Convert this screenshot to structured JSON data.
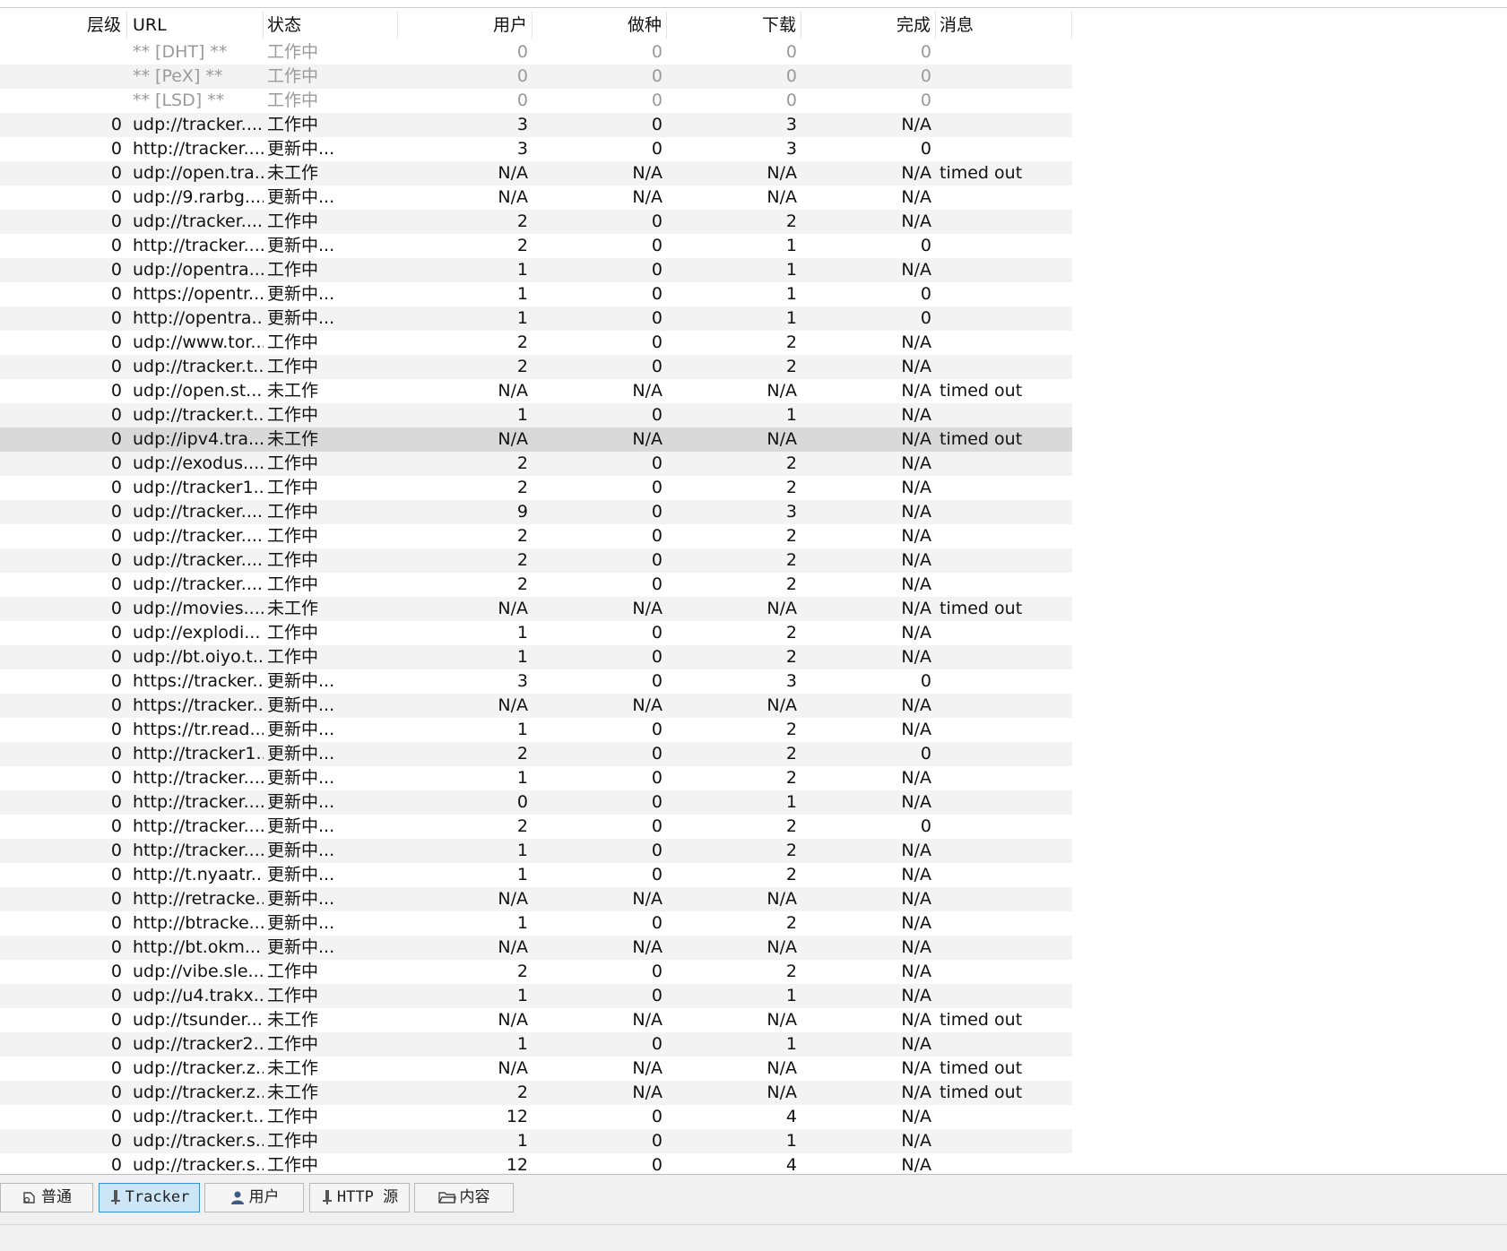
{
  "columns": {
    "tier": "层级",
    "url": "URL",
    "status": "状态",
    "peers": "用户",
    "seeds": "做种",
    "leeches": "下载",
    "downloaded": "完成",
    "message": "消息"
  },
  "rows": [
    {
      "tier": "",
      "url": "** [DHT] **",
      "status": "工作中",
      "peers": "0",
      "seeds": "0",
      "leeches": "0",
      "downloaded": "0",
      "message": "",
      "special": true
    },
    {
      "tier": "",
      "url": "** [PeX] **",
      "status": "工作中",
      "peers": "0",
      "seeds": "0",
      "leeches": "0",
      "downloaded": "0",
      "message": "",
      "special": true
    },
    {
      "tier": "",
      "url": "** [LSD] **",
      "status": "工作中",
      "peers": "0",
      "seeds": "0",
      "leeches": "0",
      "downloaded": "0",
      "message": "",
      "special": true
    },
    {
      "tier": "0",
      "url": "udp://tracker....",
      "status": "工作中",
      "peers": "3",
      "seeds": "0",
      "leeches": "3",
      "downloaded": "N/A",
      "message": ""
    },
    {
      "tier": "0",
      "url": "http://tracker....",
      "status": "更新中...",
      "peers": "3",
      "seeds": "0",
      "leeches": "3",
      "downloaded": "0",
      "message": ""
    },
    {
      "tier": "0",
      "url": "udp://open.tra...",
      "status": "未工作",
      "peers": "N/A",
      "seeds": "N/A",
      "leeches": "N/A",
      "downloaded": "N/A",
      "message": "timed out"
    },
    {
      "tier": "0",
      "url": "udp://9.rarbg....",
      "status": "更新中...",
      "peers": "N/A",
      "seeds": "N/A",
      "leeches": "N/A",
      "downloaded": "N/A",
      "message": ""
    },
    {
      "tier": "0",
      "url": "udp://tracker....",
      "status": "工作中",
      "peers": "2",
      "seeds": "0",
      "leeches": "2",
      "downloaded": "N/A",
      "message": ""
    },
    {
      "tier": "0",
      "url": "http://tracker....",
      "status": "更新中...",
      "peers": "2",
      "seeds": "0",
      "leeches": "1",
      "downloaded": "0",
      "message": ""
    },
    {
      "tier": "0",
      "url": "udp://opentra...",
      "status": "工作中",
      "peers": "1",
      "seeds": "0",
      "leeches": "1",
      "downloaded": "N/A",
      "message": ""
    },
    {
      "tier": "0",
      "url": "https://opentr...",
      "status": "更新中...",
      "peers": "1",
      "seeds": "0",
      "leeches": "1",
      "downloaded": "0",
      "message": ""
    },
    {
      "tier": "0",
      "url": "http://opentra...",
      "status": "更新中...",
      "peers": "1",
      "seeds": "0",
      "leeches": "1",
      "downloaded": "0",
      "message": ""
    },
    {
      "tier": "0",
      "url": "udp://www.tor...",
      "status": "工作中",
      "peers": "2",
      "seeds": "0",
      "leeches": "2",
      "downloaded": "N/A",
      "message": ""
    },
    {
      "tier": "0",
      "url": "udp://tracker.t...",
      "status": "工作中",
      "peers": "2",
      "seeds": "0",
      "leeches": "2",
      "downloaded": "N/A",
      "message": ""
    },
    {
      "tier": "0",
      "url": "udp://open.st...",
      "status": "未工作",
      "peers": "N/A",
      "seeds": "N/A",
      "leeches": "N/A",
      "downloaded": "N/A",
      "message": "timed out"
    },
    {
      "tier": "0",
      "url": "udp://tracker.t...",
      "status": "工作中",
      "peers": "1",
      "seeds": "0",
      "leeches": "1",
      "downloaded": "N/A",
      "message": ""
    },
    {
      "tier": "0",
      "url": "udp://ipv4.tra...",
      "status": "未工作",
      "peers": "N/A",
      "seeds": "N/A",
      "leeches": "N/A",
      "downloaded": "N/A",
      "message": "timed out",
      "selected": true
    },
    {
      "tier": "0",
      "url": "udp://exodus....",
      "status": "工作中",
      "peers": "2",
      "seeds": "0",
      "leeches": "2",
      "downloaded": "N/A",
      "message": ""
    },
    {
      "tier": "0",
      "url": "udp://tracker1...",
      "status": "工作中",
      "peers": "2",
      "seeds": "0",
      "leeches": "2",
      "downloaded": "N/A",
      "message": ""
    },
    {
      "tier": "0",
      "url": "udp://tracker....",
      "status": "工作中",
      "peers": "9",
      "seeds": "0",
      "leeches": "3",
      "downloaded": "N/A",
      "message": ""
    },
    {
      "tier": "0",
      "url": "udp://tracker....",
      "status": "工作中",
      "peers": "2",
      "seeds": "0",
      "leeches": "2",
      "downloaded": "N/A",
      "message": ""
    },
    {
      "tier": "0",
      "url": "udp://tracker....",
      "status": "工作中",
      "peers": "2",
      "seeds": "0",
      "leeches": "2",
      "downloaded": "N/A",
      "message": ""
    },
    {
      "tier": "0",
      "url": "udp://tracker....",
      "status": "工作中",
      "peers": "2",
      "seeds": "0",
      "leeches": "2",
      "downloaded": "N/A",
      "message": ""
    },
    {
      "tier": "0",
      "url": "udp://movies....",
      "status": "未工作",
      "peers": "N/A",
      "seeds": "N/A",
      "leeches": "N/A",
      "downloaded": "N/A",
      "message": "timed out"
    },
    {
      "tier": "0",
      "url": "udp://explodi...",
      "status": "工作中",
      "peers": "1",
      "seeds": "0",
      "leeches": "2",
      "downloaded": "N/A",
      "message": ""
    },
    {
      "tier": "0",
      "url": "udp://bt.oiyo.t...",
      "status": "工作中",
      "peers": "1",
      "seeds": "0",
      "leeches": "2",
      "downloaded": "N/A",
      "message": ""
    },
    {
      "tier": "0",
      "url": "https://tracker...",
      "status": "更新中...",
      "peers": "3",
      "seeds": "0",
      "leeches": "3",
      "downloaded": "0",
      "message": ""
    },
    {
      "tier": "0",
      "url": "https://tracker...",
      "status": "更新中...",
      "peers": "N/A",
      "seeds": "N/A",
      "leeches": "N/A",
      "downloaded": "N/A",
      "message": ""
    },
    {
      "tier": "0",
      "url": "https://tr.read...",
      "status": "更新中...",
      "peers": "1",
      "seeds": "0",
      "leeches": "2",
      "downloaded": "N/A",
      "message": ""
    },
    {
      "tier": "0",
      "url": "http://tracker1...",
      "status": "更新中...",
      "peers": "2",
      "seeds": "0",
      "leeches": "2",
      "downloaded": "0",
      "message": ""
    },
    {
      "tier": "0",
      "url": "http://tracker....",
      "status": "更新中...",
      "peers": "1",
      "seeds": "0",
      "leeches": "2",
      "downloaded": "N/A",
      "message": ""
    },
    {
      "tier": "0",
      "url": "http://tracker....",
      "status": "更新中...",
      "peers": "0",
      "seeds": "0",
      "leeches": "1",
      "downloaded": "N/A",
      "message": ""
    },
    {
      "tier": "0",
      "url": "http://tracker....",
      "status": "更新中...",
      "peers": "2",
      "seeds": "0",
      "leeches": "2",
      "downloaded": "0",
      "message": ""
    },
    {
      "tier": "0",
      "url": "http://tracker....",
      "status": "更新中...",
      "peers": "1",
      "seeds": "0",
      "leeches": "2",
      "downloaded": "N/A",
      "message": ""
    },
    {
      "tier": "0",
      "url": "http://t.nyaatr...",
      "status": "更新中...",
      "peers": "1",
      "seeds": "0",
      "leeches": "2",
      "downloaded": "N/A",
      "message": ""
    },
    {
      "tier": "0",
      "url": "http://retracke...",
      "status": "更新中...",
      "peers": "N/A",
      "seeds": "N/A",
      "leeches": "N/A",
      "downloaded": "N/A",
      "message": ""
    },
    {
      "tier": "0",
      "url": "http://btracke...",
      "status": "更新中...",
      "peers": "1",
      "seeds": "0",
      "leeches": "2",
      "downloaded": "N/A",
      "message": ""
    },
    {
      "tier": "0",
      "url": "http://bt.okm...",
      "status": "更新中...",
      "peers": "N/A",
      "seeds": "N/A",
      "leeches": "N/A",
      "downloaded": "N/A",
      "message": ""
    },
    {
      "tier": "0",
      "url": "udp://vibe.sle...",
      "status": "工作中",
      "peers": "2",
      "seeds": "0",
      "leeches": "2",
      "downloaded": "N/A",
      "message": ""
    },
    {
      "tier": "0",
      "url": "udp://u4.trakx...",
      "status": "工作中",
      "peers": "1",
      "seeds": "0",
      "leeches": "1",
      "downloaded": "N/A",
      "message": ""
    },
    {
      "tier": "0",
      "url": "udp://tsunder...",
      "status": "未工作",
      "peers": "N/A",
      "seeds": "N/A",
      "leeches": "N/A",
      "downloaded": "N/A",
      "message": "timed out"
    },
    {
      "tier": "0",
      "url": "udp://tracker2...",
      "status": "工作中",
      "peers": "1",
      "seeds": "0",
      "leeches": "1",
      "downloaded": "N/A",
      "message": ""
    },
    {
      "tier": "0",
      "url": "udp://tracker.z...",
      "status": "未工作",
      "peers": "N/A",
      "seeds": "N/A",
      "leeches": "N/A",
      "downloaded": "N/A",
      "message": "timed out"
    },
    {
      "tier": "0",
      "url": "udp://tracker.z...",
      "status": "未工作",
      "peers": "2",
      "seeds": "N/A",
      "leeches": "N/A",
      "downloaded": "N/A",
      "message": "timed out"
    },
    {
      "tier": "0",
      "url": "udp://tracker.t...",
      "status": "工作中",
      "peers": "12",
      "seeds": "0",
      "leeches": "4",
      "downloaded": "N/A",
      "message": ""
    },
    {
      "tier": "0",
      "url": "udp://tracker.s...",
      "status": "工作中",
      "peers": "1",
      "seeds": "0",
      "leeches": "1",
      "downloaded": "N/A",
      "message": ""
    },
    {
      "tier": "0",
      "url": "udp://tracker.s...",
      "status": "工作中",
      "peers": "12",
      "seeds": "0",
      "leeches": "4",
      "downloaded": "N/A",
      "message": ""
    }
  ],
  "tabs": [
    {
      "label": "普通",
      "icon": "general-icon",
      "active": false
    },
    {
      "label": "Tracker",
      "icon": "tracker-icon",
      "active": true
    },
    {
      "label": "用户",
      "icon": "peers-icon",
      "active": false
    },
    {
      "label": "HTTP 源",
      "icon": "http-sources-icon",
      "active": false
    },
    {
      "label": "内容",
      "icon": "folder-icon",
      "active": false
    }
  ],
  "colors": {
    "row_alt": "#f3f3f3",
    "row_selected": "#d9d9d9",
    "special_text": "#9a9a9a",
    "tab_active_bg": "#cde6f7",
    "tab_active_border": "#3c8fd0"
  }
}
